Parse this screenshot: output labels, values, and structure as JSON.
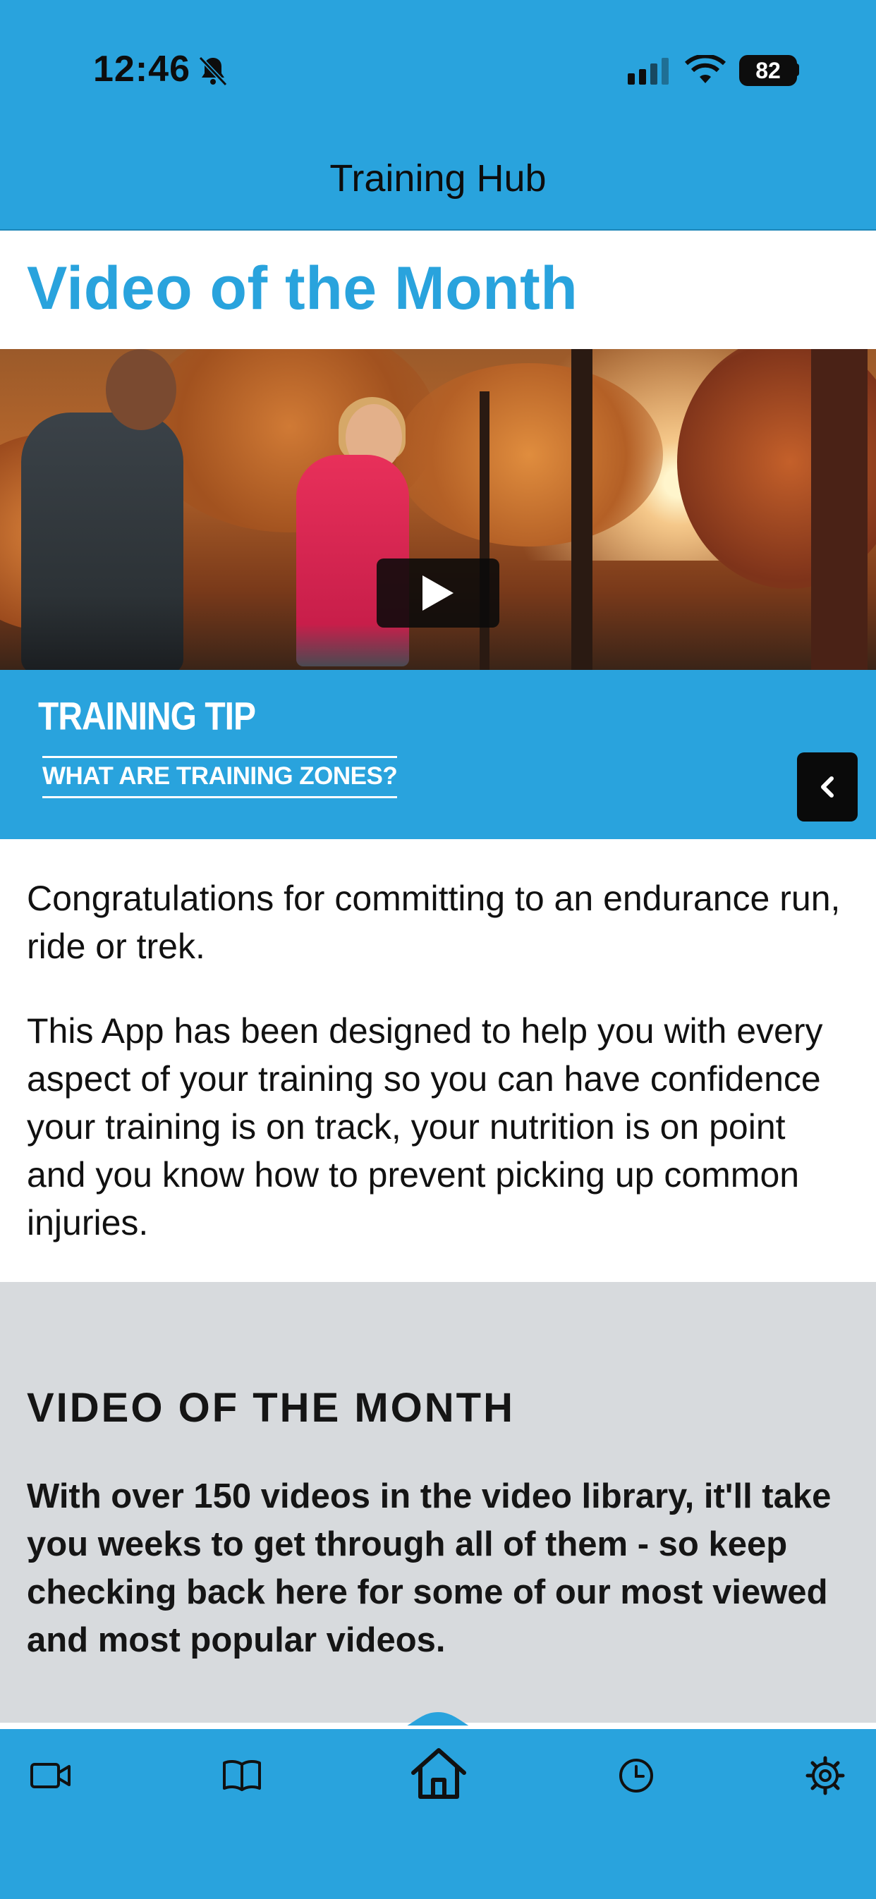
{
  "status_bar": {
    "time": "12:46",
    "battery": "82"
  },
  "nav": {
    "title": "Training Hub"
  },
  "main": {
    "title": "Video of the Month",
    "video_overlay": {
      "tip_title": "TRAINING TIP",
      "tip_subtitle": "WHAT ARE TRAINING ZONES?"
    },
    "paragraphs": [
      "Congratulations for committing to an endurance run, ride or trek.",
      "This App has been designed to help you with every aspect of your training so you can have confidence your training is on track, your nutrition is on point and you know how to prevent picking up common injuries."
    ]
  },
  "section": {
    "heading": "VIDEO OF THE MONTH",
    "text": "With over 150 videos in the video library, it'll take you weeks to get through all of them - so keep checking back here for some of our most viewed and most popular videos."
  },
  "tabbar": {
    "items": [
      {
        "icon": "video-camera-icon"
      },
      {
        "icon": "book-icon"
      },
      {
        "icon": "home-icon",
        "active": true
      },
      {
        "icon": "clock-icon"
      },
      {
        "icon": "gear-icon"
      }
    ]
  },
  "colors": {
    "accent": "#29a3dd",
    "section_bg": "#d7dadd",
    "text": "#111111"
  }
}
